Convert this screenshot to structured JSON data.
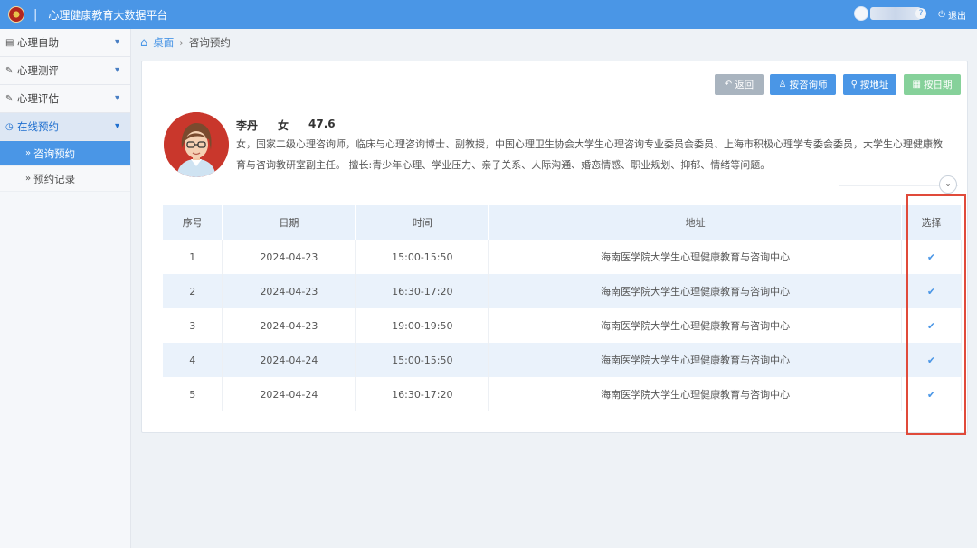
{
  "app": {
    "title": "心理健康教育大数据平台",
    "separator": "|"
  },
  "header": {
    "logout_label": "退出",
    "help_glyph": "?"
  },
  "sidebar": {
    "items": [
      {
        "label": "心理自助",
        "icon": "book-icon"
      },
      {
        "label": "心理测评",
        "icon": "edit-icon"
      },
      {
        "label": "心理评估",
        "icon": "edit-icon"
      },
      {
        "label": "在线预约",
        "icon": "clock-icon",
        "active": true
      }
    ],
    "subitems": [
      {
        "label": "咨询预约",
        "selected": true
      },
      {
        "label": "预约记录",
        "selected": false
      }
    ]
  },
  "breadcrumb": {
    "home": "桌面",
    "current": "咨询预约"
  },
  "toolbar": {
    "back": "返回",
    "by_counselor": "按咨询师",
    "by_address": "按地址",
    "by_date": "按日期"
  },
  "counselor": {
    "name": "李丹",
    "gender": "女",
    "score": "47.6",
    "description": "女，国家二级心理咨询师，临床与心理咨询博士、副教授，中国心理卫生协会大学生心理咨询专业委员会委员、上海市积极心理学专委会委员，大学生心理健康教育与咨询教研室副主任。 擅长:青少年心理、学业压力、亲子关系、人际沟通、婚恋情感、职业规划、抑郁、情绪等问题。"
  },
  "table": {
    "headers": [
      "序号",
      "日期",
      "时间",
      "地址",
      "选择"
    ],
    "rows": [
      {
        "no": "1",
        "date": "2024-04-23",
        "time": "15:00-15:50",
        "address": "海南医学院大学生心理健康教育与咨询中心"
      },
      {
        "no": "2",
        "date": "2024-04-23",
        "time": "16:30-17:20",
        "address": "海南医学院大学生心理健康教育与咨询中心"
      },
      {
        "no": "3",
        "date": "2024-04-23",
        "time": "19:00-19:50",
        "address": "海南医学院大学生心理健康教育与咨询中心"
      },
      {
        "no": "4",
        "date": "2024-04-24",
        "time": "15:00-15:50",
        "address": "海南医学院大学生心理健康教育与咨询中心"
      },
      {
        "no": "5",
        "date": "2024-04-24",
        "time": "16:30-17:20",
        "address": "海南医学院大学生心理健康教育与咨询中心"
      }
    ]
  },
  "colors": {
    "primary": "#4a96e6",
    "success": "#86d19a",
    "muted": "#a9b4bf",
    "highlight": "#e04a3a"
  }
}
